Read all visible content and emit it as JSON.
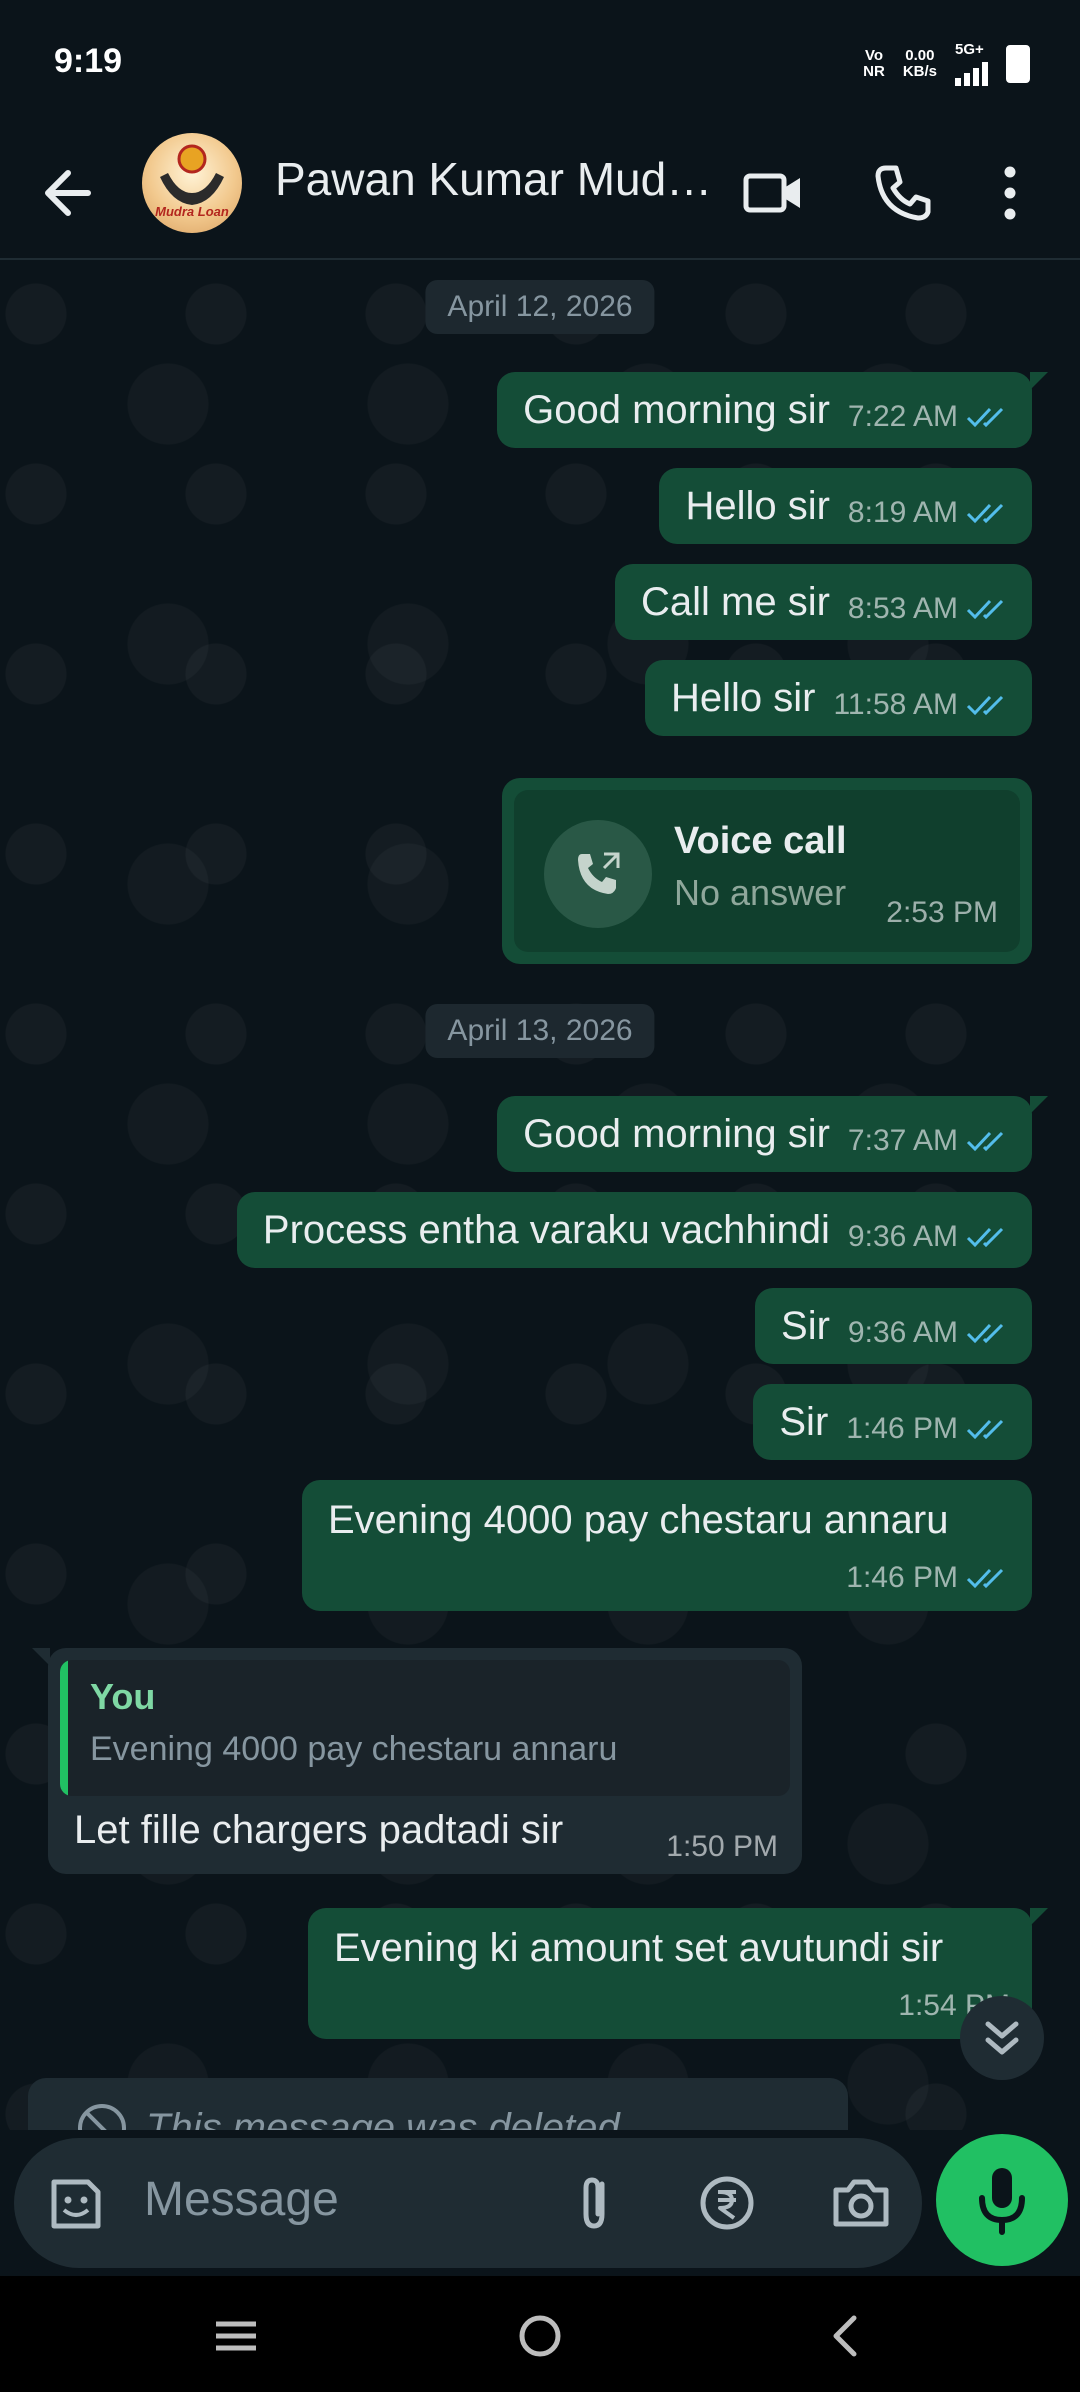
{
  "status_bar": {
    "time": "9:19",
    "volte_top": "Vo",
    "volte_bottom": "NR",
    "speed_value": "0.00",
    "speed_unit": "KB/s",
    "network": "5G+"
  },
  "header": {
    "contact_name": "Pawan Kumar Mud…",
    "avatar_text": "Mudra Loan"
  },
  "chat": {
    "date_1": "April 12, 2026",
    "date_2": "April 13, 2026",
    "messages": [
      {
        "text": "Good morning sir",
        "time": "7:22 AM"
      },
      {
        "text": "Hello sir",
        "time": "8:19 AM"
      },
      {
        "text": "Call me sir",
        "time": "8:53 AM"
      },
      {
        "text": "Hello sir",
        "time": "11:58 AM"
      },
      {
        "text": "Good morning sir",
        "time": "7:37 AM"
      },
      {
        "text": "Process entha varaku vachhindi",
        "time": "9:36 AM"
      },
      {
        "text": "Sir",
        "time": "9:36 AM"
      },
      {
        "text": "Sir",
        "time": "1:46 PM"
      },
      {
        "text": "Evening 4000 pay chestaru annaru",
        "time": "1:46 PM"
      },
      {
        "text": "Evening ki amount set avutundi sir",
        "time": "1:54 PM"
      }
    ],
    "call": {
      "title": "Voice call",
      "status": "No answer",
      "time": "2:53 PM"
    },
    "reply": {
      "quoted_name": "You",
      "quoted_text": "Evening 4000 pay chestaru annaru",
      "text": "Let fille chargers padtadi sir",
      "time": "1:50 PM"
    },
    "deleted_text": "This message was deleted"
  },
  "composer": {
    "placeholder": "Message"
  },
  "colors": {
    "background": "#0b141a",
    "outgoing_bubble": "#144d37",
    "incoming_bubble": "#1f2c33",
    "read_tick": "#53bdeb",
    "accent_green": "#21c063"
  }
}
